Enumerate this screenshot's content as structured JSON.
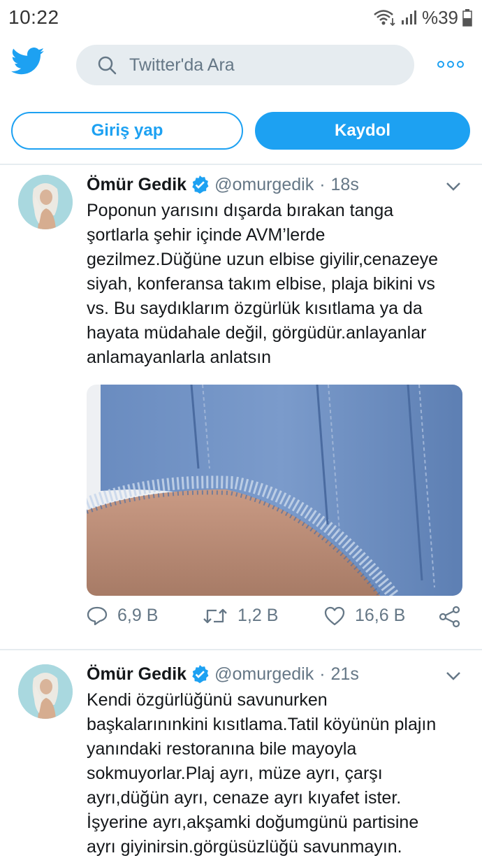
{
  "status_bar": {
    "time": "10:22",
    "battery": "%39"
  },
  "topbar": {
    "logo": "twitter-bird-icon",
    "search_placeholder": "Twitter'da Ara",
    "more": "more-icon"
  },
  "auth": {
    "login_label": "Giriş yap",
    "signup_label": "Kaydol"
  },
  "colors": {
    "brand": "#1da1f2",
    "muted": "#657786",
    "search_bg": "#e6ecf0"
  },
  "tweets": [
    {
      "name": "Ömür Gedik",
      "handle": "@omurgedik",
      "separator": "·",
      "time": "18s",
      "text": "Poponun yarısını dışarda bırakan tanga\nşortlarla şehir içinde AVM’lerde\ngezilmez.Düğüne uzun elbise giyilir,cenazeye\nsiyah, konferansa takım elbise, plaja bikini vs\nvs. Bu saydıklarım özgürlük kısıtlama ya da\nhayata müdahale değil, görgüdür.anlayanlar\nanlamayanlarla anlatsın",
      "replies": "6,9 B",
      "retweets": "1,2 B",
      "likes": "16,6 B"
    },
    {
      "name": "Ömür Gedik",
      "handle": "@omurgedik",
      "separator": "·",
      "time": "21s",
      "text": "Kendi özgürlüğünü savunurken\nbaşkalarınınkini kısıtlama.Tatil köyünün plajın\nyanındaki restoranına bile mayoyla\nsokmuyorlar.Plaj ayrı, müze ayrı, çarşı\nayrı,düğün ayrı, cenaze ayrı kıyafet ister.\nİşyerine ayrı,akşamki doğumgünü partisine\nayrı giyinirsin.görgüsüzlüğü savunmayın."
    }
  ]
}
